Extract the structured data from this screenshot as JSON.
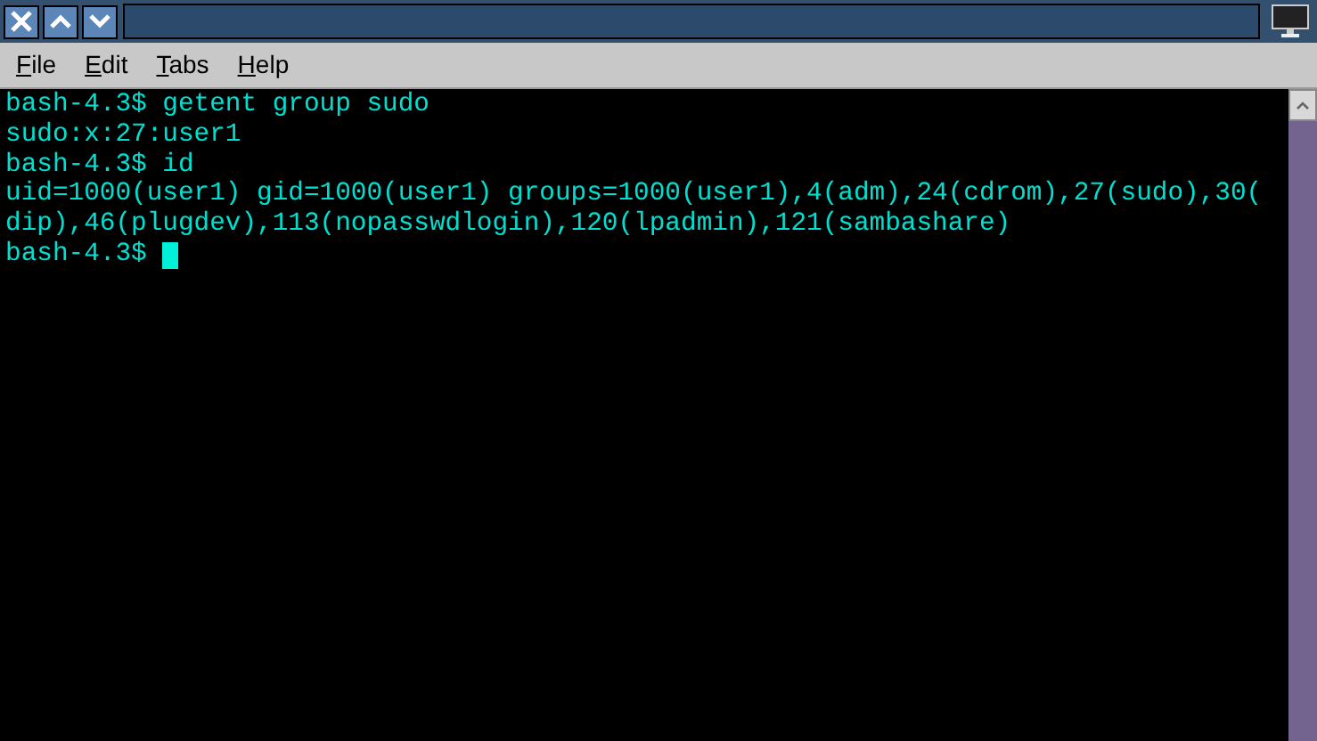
{
  "menu": [
    {
      "label": "File"
    },
    {
      "label": "Edit"
    },
    {
      "label": "Tabs"
    },
    {
      "label": "Help"
    }
  ],
  "terminal": {
    "lines": [
      {
        "text": "bash-4.3$ getent group sudo",
        "cursor": false
      },
      {
        "text": "sudo:x:27:user1",
        "cursor": false
      },
      {
        "text": "bash-4.3$ id",
        "cursor": false
      },
      {
        "text": "uid=1000(user1) gid=1000(user1) groups=1000(user1),4(adm),24(cdrom),27(sudo),30(",
        "cursor": false
      },
      {
        "text": "dip),46(plugdev),113(nopasswdlogin),120(lpadmin),121(sambashare)",
        "cursor": false
      },
      {
        "text": "bash-4.3$ ",
        "cursor": true
      }
    ]
  }
}
